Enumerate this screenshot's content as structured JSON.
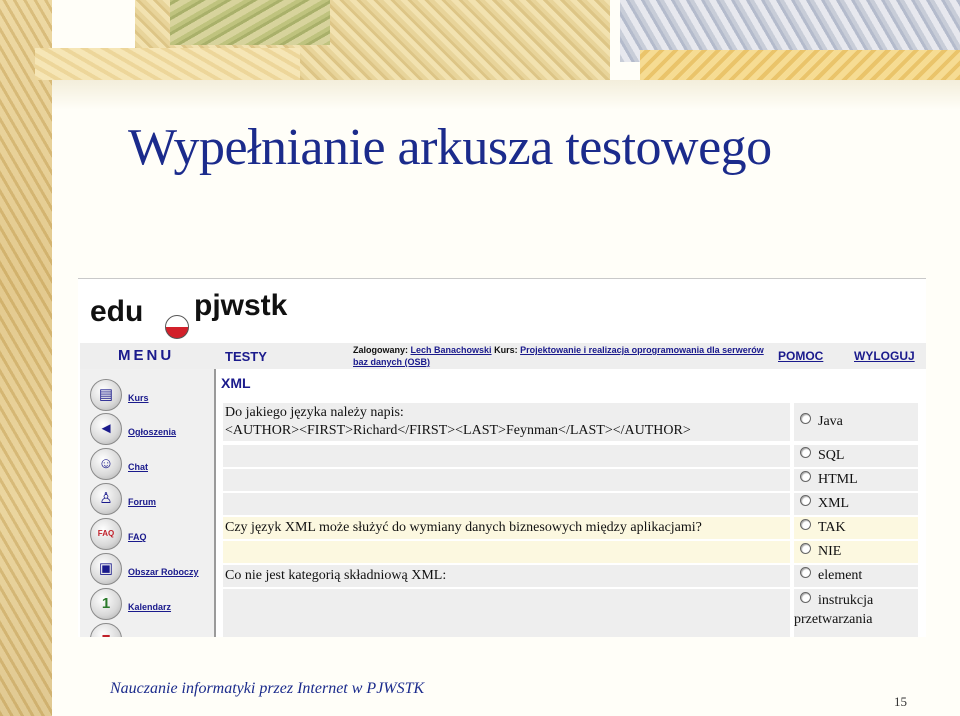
{
  "slide": {
    "title": "Wypełnianie arkusza testowego",
    "footer": "Nauczanie informatyki przez Internet w PJWSTK",
    "page_number": "15"
  },
  "app": {
    "logo_left": "edu",
    "logo_right": "pjwstk",
    "menu_label": "MENU",
    "section_label": "TESTY",
    "login_prefix": "Zalogowany:",
    "user_name": "Lech Banachowski",
    "course_prefix": "Kurs:",
    "course_name": "Projektowanie i realizacja oprogramowania dla serwerów baz danych (OSB)",
    "help_link": "POMOC",
    "logout_link": "WYLOGUJ",
    "content_title": "XML"
  },
  "sidebar": {
    "items": [
      {
        "label": "Kurs",
        "icon": "network-icon"
      },
      {
        "label": "Ogłoszenia",
        "icon": "megaphone-icon"
      },
      {
        "label": "Chat",
        "icon": "faces-icon"
      },
      {
        "label": "Forum",
        "icon": "people-icon"
      },
      {
        "label": "FAQ",
        "icon": "faq-icon"
      },
      {
        "label": "Obszar Roboczy",
        "icon": "floppy-icon"
      },
      {
        "label": "Kalendarz",
        "icon": "calendar-icon"
      },
      {
        "label": "",
        "icon": "book-icon"
      }
    ]
  },
  "test": {
    "q1_line1": "Do jakiego języka należy napis:",
    "q1_line2": "<AUTHOR><FIRST>Richard</FIRST><LAST>Feynman</LAST></AUTHOR>",
    "q1_options": [
      "Java",
      "SQL",
      "HTML",
      "XML"
    ],
    "q2_text": "Czy język XML może służyć do wymiany danych biznesowych między aplikacjami?",
    "q2_options": [
      "TAK",
      "NIE"
    ],
    "q3_text": "Co nie jest kategorią składniową XML:",
    "q3_options": [
      "element",
      "instrukcja przetwarzania"
    ]
  }
}
